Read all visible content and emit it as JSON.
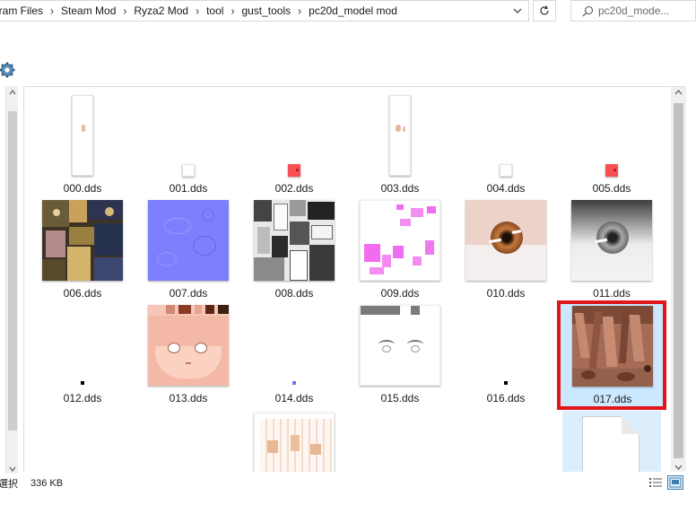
{
  "address": {
    "crumbs": [
      "gram Files",
      "Steam Mod",
      "Ryza2 Mod",
      "tool",
      "gust_tools",
      "pc20d_model mod"
    ]
  },
  "search": {
    "placeholder": "pc20d_mode..."
  },
  "files": [
    {
      "name": "000.dds"
    },
    {
      "name": "001.dds"
    },
    {
      "name": "002.dds"
    },
    {
      "name": "003.dds"
    },
    {
      "name": "004.dds"
    },
    {
      "name": "005.dds"
    },
    {
      "name": "006.dds"
    },
    {
      "name": "007.dds"
    },
    {
      "name": "008.dds"
    },
    {
      "name": "009.dds"
    },
    {
      "name": "010.dds"
    },
    {
      "name": "011.dds"
    },
    {
      "name": "012.dds"
    },
    {
      "name": "013.dds"
    },
    {
      "name": "014.dds"
    },
    {
      "name": "015.dds"
    },
    {
      "name": "016.dds"
    },
    {
      "name": "017.dds"
    }
  ],
  "selected_file": "017.dds",
  "status": {
    "selection": "選択",
    "size": "336 KB"
  },
  "colors": {
    "selection_bg": "#cce8ff",
    "selection_border": "#99d1ff",
    "highlight": "#e0151b"
  },
  "icons": [
    "chevron-right-icon",
    "dropdown-icon",
    "refresh-icon",
    "search-icon",
    "gear-icon",
    "details-view-icon",
    "large-icons-view-icon"
  ]
}
